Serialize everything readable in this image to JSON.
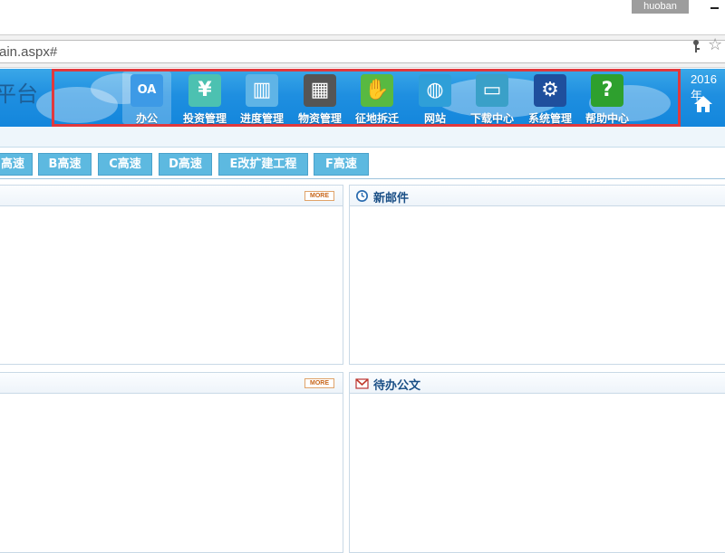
{
  "window": {
    "user": "huoban"
  },
  "address": {
    "url": "ain.aspx#"
  },
  "header": {
    "brand": "平台",
    "year": "2016年",
    "nav": [
      {
        "label": "办公",
        "icon": "oa-cloud-icon",
        "color": "#3d9ae6",
        "active": true
      },
      {
        "label": "投资管理",
        "icon": "yen-icon",
        "color": "#4cc1b1"
      },
      {
        "label": "进度管理",
        "icon": "progress-chart-icon",
        "color": "#5fb4e6"
      },
      {
        "label": "物资管理",
        "icon": "materials-photo-icon",
        "color": "#555555"
      },
      {
        "label": "征地拆迁",
        "icon": "handshake-icon",
        "color": "#58b941"
      },
      {
        "label": "网站",
        "icon": "globe-icon",
        "color": "#2f9fd8"
      },
      {
        "label": "下载中心",
        "icon": "folder-icon",
        "color": "#3aa0c8"
      },
      {
        "label": "系统管理",
        "icon": "gear-icon",
        "color": "#1f4f9d"
      },
      {
        "label": "帮助中心",
        "icon": "help-icon",
        "color": "#2ea02e"
      }
    ]
  },
  "tabs": [
    "高速",
    "B高速",
    "C高速",
    "D高速",
    "E改扩建工程",
    "F高速"
  ],
  "panels": {
    "top_left": {
      "more": "MORE"
    },
    "top_right": {
      "title": "新邮件",
      "icon": "clock-icon"
    },
    "bottom_left": {
      "more": "MORE"
    },
    "bottom_right": {
      "title": "待办公文",
      "icon": "mail-icon"
    }
  },
  "colors": {
    "header_blue": "#1f8fe0",
    "tab_blue": "#5db9e0",
    "highlight_red": "#e0393d"
  }
}
